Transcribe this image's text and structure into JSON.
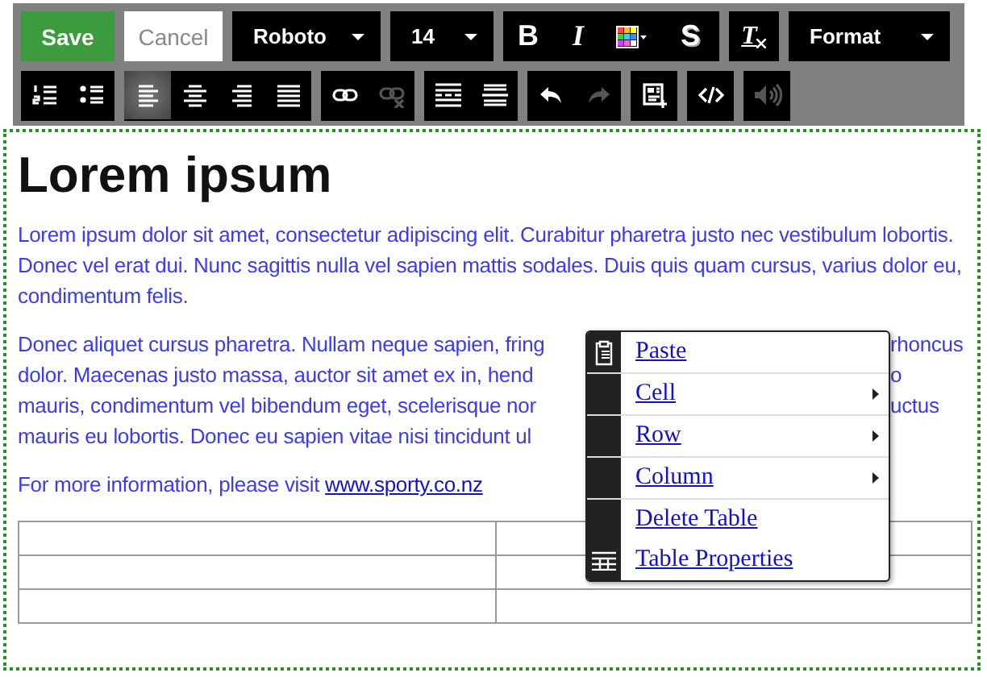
{
  "toolbar": {
    "rows": [
      [
        {
          "buttons": [
            {
              "kind": "primary",
              "label": "Save"
            }
          ]
        },
        {
          "buttons": [
            {
              "kind": "plain",
              "label": "Cancel"
            }
          ]
        },
        {
          "buttons": [
            {
              "kind": "dropdown",
              "value": "Roboto"
            }
          ]
        },
        {
          "buttons": [
            {
              "kind": "dropdown",
              "value": "14"
            }
          ]
        },
        {
          "buttons": [
            {
              "kind": "bold",
              "label": "B",
              "selected": false,
              "disabled": false
            },
            {
              "kind": "italic",
              "label": "I",
              "selected": false,
              "disabled": false
            },
            {
              "kind": "palette",
              "selected": false,
              "disabled": false
            },
            {
              "kind": "shadow",
              "label": "S",
              "selected": false,
              "disabled": false
            }
          ]
        },
        {
          "buttons": [
            {
              "kind": "clear",
              "label": "T",
              "selected": false,
              "disabled": false
            }
          ]
        },
        {
          "buttons": [
            {
              "kind": "dropdown",
              "value": "Format"
            }
          ]
        }
      ],
      [
        {
          "buttons": [
            {
              "kind": "numbered",
              "selected": false,
              "disabled": false
            },
            {
              "kind": "bullets",
              "selected": false,
              "disabled": false
            }
          ]
        },
        {
          "buttons": [
            {
              "kind": "alignleft",
              "selected": true,
              "disabled": false
            },
            {
              "kind": "aligncenter",
              "selected": false,
              "disabled": false
            },
            {
              "kind": "alignright",
              "selected": false,
              "disabled": false
            },
            {
              "kind": "justify",
              "selected": false,
              "disabled": false
            }
          ]
        },
        {
          "buttons": [
            {
              "kind": "link",
              "selected": false,
              "disabled": false
            },
            {
              "kind": "unlink",
              "selected": false,
              "disabled": true
            }
          ]
        },
        {
          "buttons": [
            {
              "kind": "dashed",
              "selected": false,
              "disabled": false
            },
            {
              "kind": "rule",
              "selected": false,
              "disabled": false
            }
          ]
        },
        {
          "buttons": [
            {
              "kind": "undo",
              "selected": false,
              "disabled": false
            },
            {
              "kind": "redo",
              "selected": false,
              "disabled": true
            }
          ]
        },
        {
          "buttons": [
            {
              "kind": "template",
              "selected": false,
              "disabled": false
            }
          ]
        },
        {
          "buttons": [
            {
              "kind": "code",
              "selected": false,
              "disabled": false
            }
          ]
        },
        {
          "buttons": [
            {
              "kind": "speaker",
              "selected": false,
              "disabled": true
            }
          ]
        }
      ]
    ]
  },
  "content": {
    "heading": "Lorem ipsum",
    "paragraph_1": "Lorem ipsum dolor sit amet, consectetur adipiscing elit. Curabitur pharetra justo nec vestibulum lobortis. Donec vel erat dui. Nunc sagittis nulla vel sapien mattis sodales. Duis quis quam cursus, varius dolor eu, condimentum felis.",
    "paragraph_2_lines": [
      {
        "left": "Donec aliquet cursus pharetra. Nullam neque sapien, fring",
        "right": "rhoncus"
      },
      {
        "left": "dolor. Maecenas justo massa, auctor sit amet ex in, hend",
        "right": "o"
      },
      {
        "left": "mauris, condimentum vel bibendum eget, scelerisque nor",
        "right": "uctus"
      },
      {
        "left": "mauris eu lobortis. Donec eu sapien vitae nisi tincidunt ul"
      }
    ],
    "paragraph_3": {
      "text": "For more information, please visit ",
      "link": "www.sporty.co.nz"
    },
    "table": {
      "rows": [
        {
          "cells": [
            {
              "kind": "empty"
            },
            {
              "kind": "empty"
            }
          ]
        },
        {
          "cells": [
            {
              "kind": "empty"
            },
            {
              "kind": "empty"
            }
          ]
        },
        {
          "cells": [
            {
              "kind": "empty"
            },
            {
              "kind": "empty"
            }
          ]
        }
      ]
    }
  },
  "context_menu": {
    "items": [
      {
        "label": "Paste",
        "kind": "clipboard",
        "submenu": false,
        "divider": true
      },
      {
        "label": "Cell",
        "kind": "plain",
        "submenu": true,
        "divider": true
      },
      {
        "label": "Row",
        "kind": "plain",
        "submenu": true,
        "divider": true
      },
      {
        "label": "Column",
        "kind": "plain",
        "submenu": true,
        "divider": true
      },
      {
        "label": "Delete Table",
        "kind": "plain",
        "submenu": false,
        "divider": false
      },
      {
        "label": "Table Properties",
        "kind": "table",
        "submenu": false,
        "divider": false
      }
    ]
  }
}
